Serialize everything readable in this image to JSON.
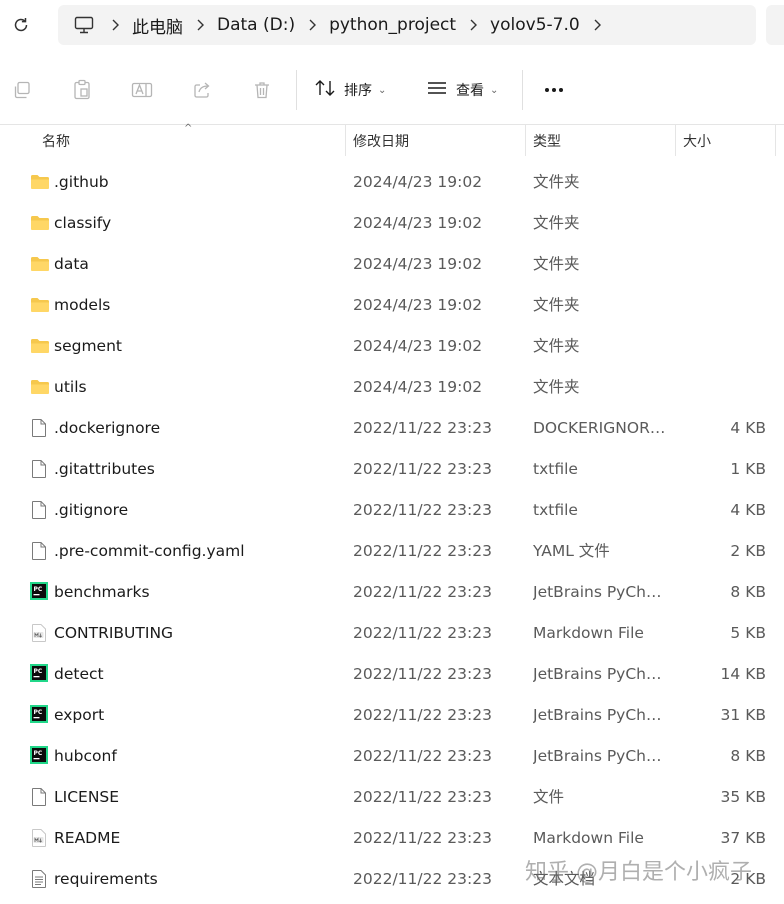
{
  "address_bar": {
    "breadcrumbs": [
      "此电脑",
      "Data (D:)",
      "python_project",
      "yolov5-7.0"
    ]
  },
  "toolbar": {
    "sort_label": "排序",
    "view_label": "查看"
  },
  "columns": {
    "name": "名称",
    "date": "修改日期",
    "type": "类型",
    "size": "大小"
  },
  "files": [
    {
      "name": ".github",
      "date": "2024/4/23 19:02",
      "type": "文件夹",
      "size": "",
      "icon": "folder-icon"
    },
    {
      "name": "classify",
      "date": "2024/4/23 19:02",
      "type": "文件夹",
      "size": "",
      "icon": "folder-icon"
    },
    {
      "name": "data",
      "date": "2024/4/23 19:02",
      "type": "文件夹",
      "size": "",
      "icon": "folder-icon"
    },
    {
      "name": "models",
      "date": "2024/4/23 19:02",
      "type": "文件夹",
      "size": "",
      "icon": "folder-icon"
    },
    {
      "name": "segment",
      "date": "2024/4/23 19:02",
      "type": "文件夹",
      "size": "",
      "icon": "folder-icon"
    },
    {
      "name": "utils",
      "date": "2024/4/23 19:02",
      "type": "文件夹",
      "size": "",
      "icon": "folder-icon"
    },
    {
      "name": ".dockerignore",
      "date": "2022/11/22 23:23",
      "type": "DOCKERIGNORE...",
      "size": "4 KB",
      "icon": "file-icon"
    },
    {
      "name": ".gitattributes",
      "date": "2022/11/22 23:23",
      "type": "txtfile",
      "size": "1 KB",
      "icon": "file-icon"
    },
    {
      "name": ".gitignore",
      "date": "2022/11/22 23:23",
      "type": "txtfile",
      "size": "4 KB",
      "icon": "file-icon"
    },
    {
      "name": ".pre-commit-config.yaml",
      "date": "2022/11/22 23:23",
      "type": "YAML 文件",
      "size": "2 KB",
      "icon": "file-icon"
    },
    {
      "name": "benchmarks",
      "date": "2022/11/22 23:23",
      "type": "JetBrains PyChar...",
      "size": "8 KB",
      "icon": "pycharm-icon"
    },
    {
      "name": "CONTRIBUTING",
      "date": "2022/11/22 23:23",
      "type": "Markdown File",
      "size": "5 KB",
      "icon": "markdown-icon"
    },
    {
      "name": "detect",
      "date": "2022/11/22 23:23",
      "type": "JetBrains PyChar...",
      "size": "14 KB",
      "icon": "pycharm-icon"
    },
    {
      "name": "export",
      "date": "2022/11/22 23:23",
      "type": "JetBrains PyChar...",
      "size": "31 KB",
      "icon": "pycharm-icon"
    },
    {
      "name": "hubconf",
      "date": "2022/11/22 23:23",
      "type": "JetBrains PyChar...",
      "size": "8 KB",
      "icon": "pycharm-icon"
    },
    {
      "name": "LICENSE",
      "date": "2022/11/22 23:23",
      "type": "文件",
      "size": "35 KB",
      "icon": "file-icon"
    },
    {
      "name": "README",
      "date": "2022/11/22 23:23",
      "type": "Markdown File",
      "size": "37 KB",
      "icon": "markdown-icon"
    },
    {
      "name": "requirements",
      "date": "2022/11/22 23:23",
      "type": "文本文档",
      "size": "2 KB",
      "icon": "text-file-icon"
    }
  ],
  "watermark": "知乎 @月白是个小疯子",
  "colors": {
    "folder": "#f2c94c",
    "pycharm": "#21d789",
    "accent": "#1a1a1a"
  }
}
